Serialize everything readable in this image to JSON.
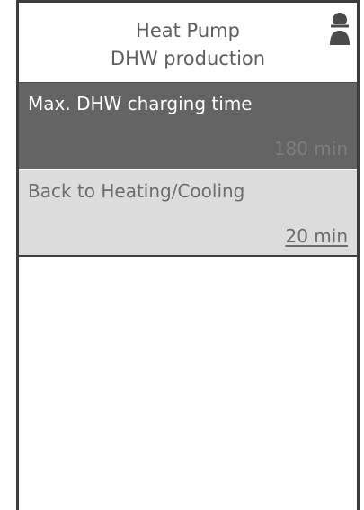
{
  "header": {
    "title": "Heat Pump",
    "subtitle": "DHW production",
    "user_icon": "user-icon"
  },
  "settings": [
    {
      "label": "Max. DHW charging time",
      "value": "180 min",
      "selected": true
    },
    {
      "label": "Back to Heating/Cooling",
      "value": "20 min",
      "selected": false
    }
  ],
  "colors": {
    "selected_row_bg": "#646464",
    "row_bg": "#dcdcdc",
    "border": "#3d3d3d",
    "header_text": "#5e5e5e"
  }
}
